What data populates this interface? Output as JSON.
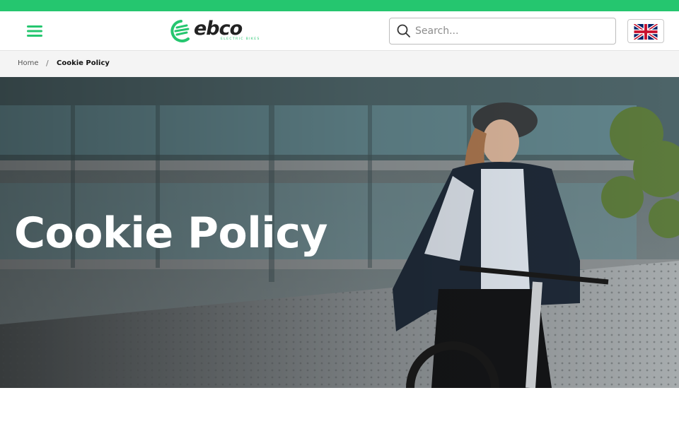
{
  "header": {
    "menu_icon": "hamburger-menu-icon",
    "logo": {
      "brand": "ebco",
      "tagline": "ELECTRIC BIKES",
      "accent_color": "#25c66f"
    },
    "search": {
      "placeholder": "Search...",
      "value": "",
      "icon": "search-icon"
    },
    "language": {
      "icon": "uk-flag-icon"
    }
  },
  "breadcrumb": {
    "home": "Home",
    "separator": "/",
    "current": "Cookie Policy"
  },
  "hero": {
    "title": "Cookie Policy"
  },
  "colors": {
    "accent": "#25c66f",
    "breadcrumb_bg": "#f4f4f4"
  }
}
